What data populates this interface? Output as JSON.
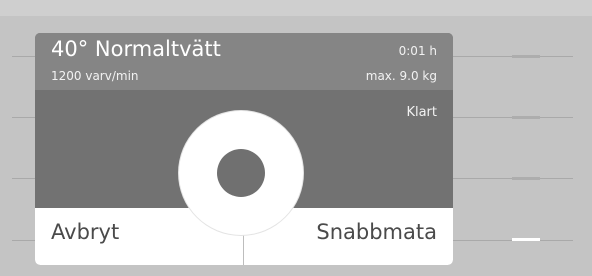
{
  "program": {
    "title": "40° Normaltvätt",
    "spin": "1200 varv/min",
    "time": "0:01 h",
    "max_load": "max. 9.0 kg",
    "status": "Klart"
  },
  "actions": {
    "cancel_label": "Avbryt",
    "quick_feed_label": "Snabbmata"
  },
  "side_indicators": {
    "count": "4",
    "active": "4"
  },
  "colors": {
    "background": "#c4c4c4",
    "header": "#858585",
    "panel": "#727272",
    "button_bar": "#ffffff",
    "text_light": "#ffffff",
    "text_dark": "#4a4a4a"
  }
}
